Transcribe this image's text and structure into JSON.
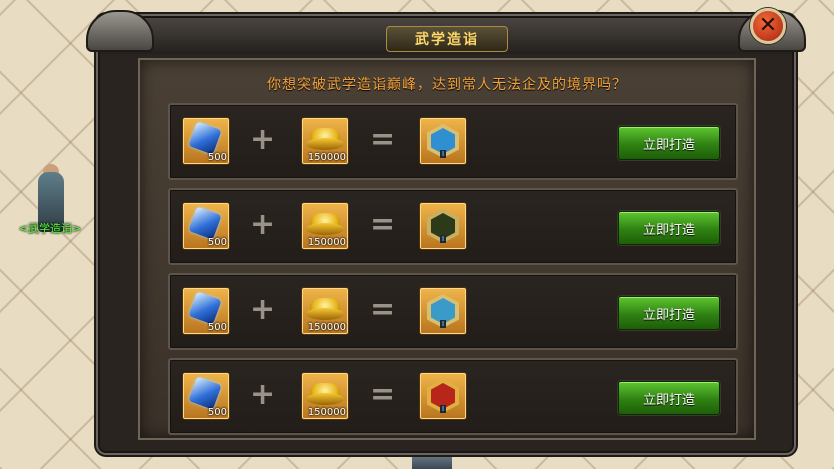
{
  "npc": {
    "label": "<武学造诣>"
  },
  "dialog": {
    "title": "武学造诣",
    "question": "你想突破武学造诣巅峰，达到常人无法企及的境界吗？",
    "close_symbol": "✕",
    "rows": [
      {
        "gem_count": "500",
        "gold_count": "150000",
        "reward_rank": "I",
        "reward_color": "#2f8fd0",
        "button": "立即打造"
      },
      {
        "gem_count": "500",
        "gold_count": "150000",
        "reward_rank": "I",
        "reward_color": "#2c3a1a",
        "button": "立即打造"
      },
      {
        "gem_count": "500",
        "gold_count": "150000",
        "reward_rank": "I",
        "reward_color": "#3a9ac8",
        "button": "立即打造"
      },
      {
        "gem_count": "500",
        "gold_count": "150000",
        "reward_rank": "I",
        "reward_color": "#b8261a",
        "button": "立即打造"
      }
    ],
    "plus_symbol": "+",
    "equals_symbol": "="
  },
  "icons": {
    "gem": "blue-gem-icon",
    "gold": "gold-ingot-icon",
    "reward": "martial-emblem-icon"
  }
}
